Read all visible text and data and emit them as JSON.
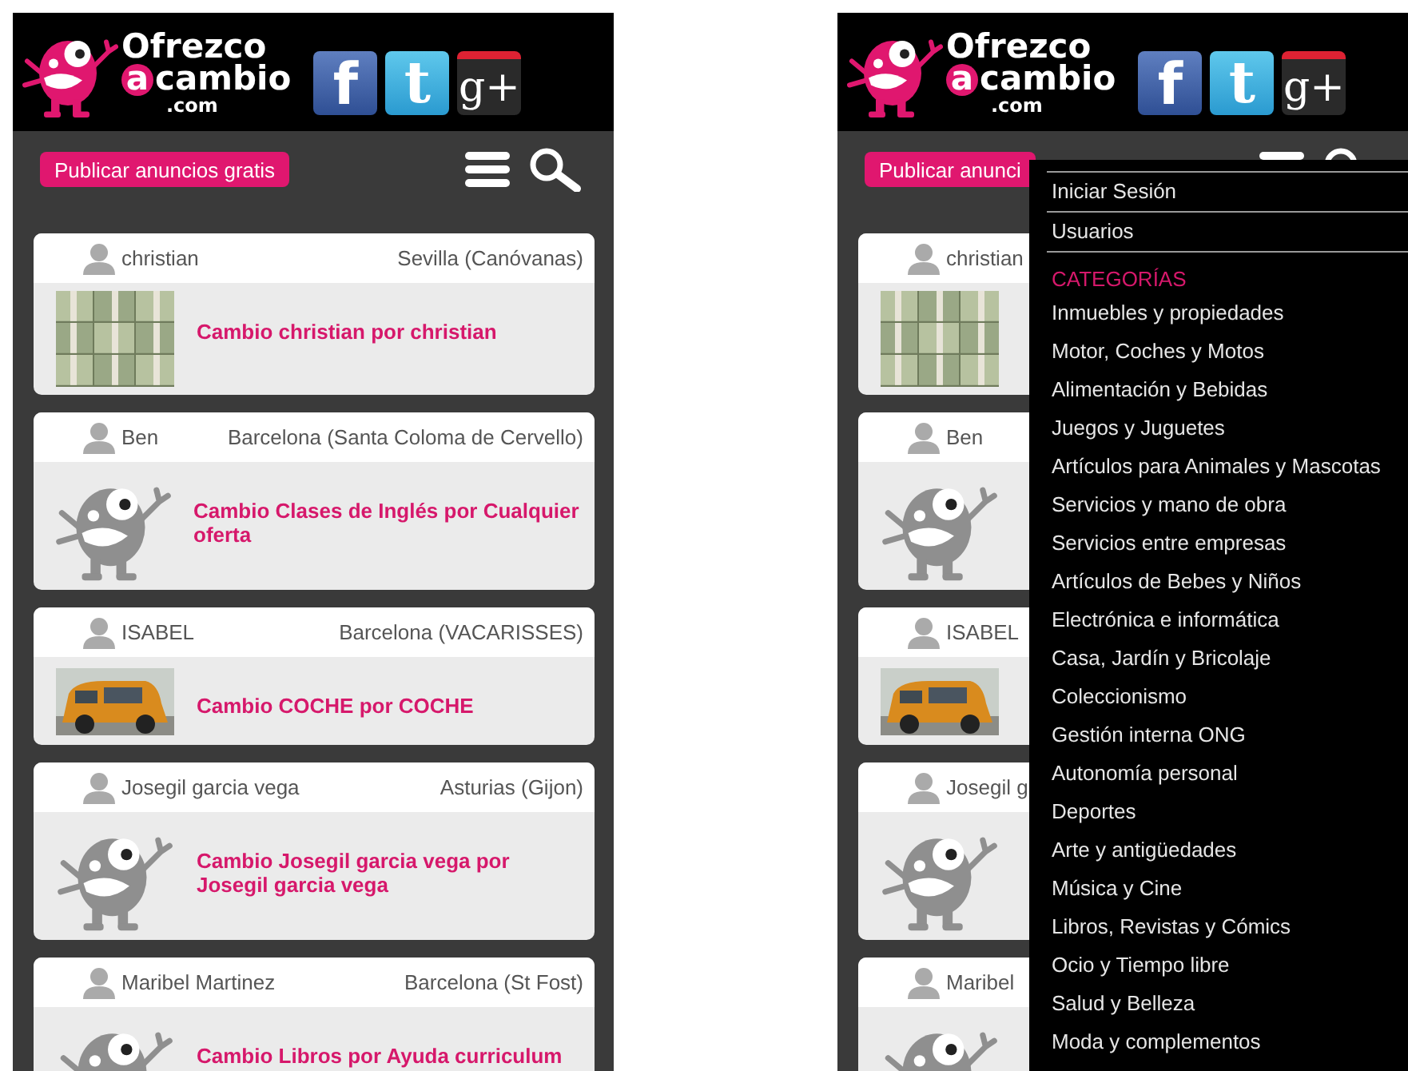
{
  "phones": [
    {
      "logo": {
        "line1": "Ofrezco",
        "badge": "a",
        "line2": "cambio",
        "line3": ".com"
      },
      "social": [
        {
          "kind": "facebook",
          "label": "f"
        },
        {
          "kind": "twitter",
          "label": "t"
        },
        {
          "kind": "googleplus",
          "label": "g+"
        }
      ],
      "publish_button": "Publicar anuncios gratis",
      "cards": [
        {
          "user": "christian",
          "location": "Sevilla (Canóvanas)",
          "image": {
            "kind": "picture"
          },
          "title_lines": [
            "Cambio christian por christian"
          ]
        },
        {
          "user": "Ben",
          "location": "Barcelona (Santa Coloma de Cervello)",
          "image": {
            "kind": "mascot"
          },
          "title_lines": [
            "Cambio Clases de Inglés por Cualquier",
            "oferta"
          ]
        },
        {
          "user": "ISABEL",
          "location": "Barcelona (VACARISSES)",
          "image": {
            "kind": "picture"
          },
          "title_lines": [
            "Cambio COCHE por COCHE"
          ]
        },
        {
          "user": "Josegil garcia vega",
          "location": "Asturias (Gijon)",
          "image": {
            "kind": "mascot"
          },
          "title_lines": [
            "Cambio Josegil garcia vega por",
            "Josegil garcia vega"
          ]
        },
        {
          "user": "Maribel Martinez",
          "location": "Barcelona (St Fost)",
          "image": {
            "kind": "mascot"
          },
          "title_lines": [
            "Cambio Libros por Ayuda curriculum"
          ]
        }
      ]
    },
    {
      "logo": {
        "line1": "Ofrezco",
        "badge": "a",
        "line2": "cambio",
        "line3": ".com"
      },
      "social": [
        {
          "kind": "facebook",
          "label": "f"
        },
        {
          "kind": "twitter",
          "label": "t"
        },
        {
          "kind": "googleplus",
          "label": "g+"
        }
      ],
      "publish_button": "Publicar anunci",
      "cards": [
        {
          "user": "christian",
          "image": {
            "kind": "picture"
          }
        },
        {
          "user": "Ben",
          "image": {
            "kind": "mascot"
          }
        },
        {
          "user": "ISABEL",
          "image": {
            "kind": "picture"
          }
        },
        {
          "user": "Josegil g",
          "image": {
            "kind": "mascot"
          }
        },
        {
          "user": "Maribel",
          "image": {
            "kind": "mascot"
          }
        }
      ],
      "menu": {
        "account_items": [
          "Iniciar Sesión",
          "Usuarios"
        ],
        "section_title": "CATEGORÍAS",
        "categories": [
          "Inmuebles y propiedades",
          "Motor, Coches y Motos",
          "Alimentación y Bebidas",
          "Juegos y Juguetes",
          "Artículos para Animales y Mascotas",
          "Servicios y mano de obra",
          "Servicios entre empresas",
          "Artículos de Bebes y Niños",
          "Electrónica e informática",
          "Casa, Jardín y Bricolaje",
          "Coleccionismo",
          "Gestión interna ONG",
          "Autonomía personal",
          "Deportes",
          "Arte y antigüedades",
          "Música y Cine",
          "Libros, Revistas y Cómics",
          "Ocio y Tiempo libre",
          "Salud y Belleza",
          "Moda y complementos"
        ]
      }
    }
  ]
}
